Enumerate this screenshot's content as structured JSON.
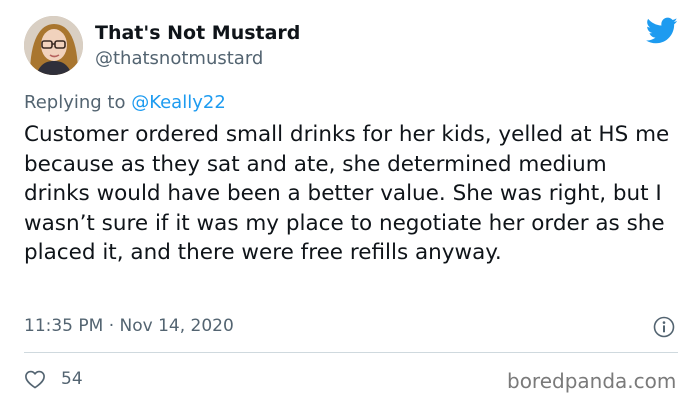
{
  "tweet": {
    "author": {
      "display_name": "That's Not Mustard",
      "handle": "@thatsnotmustard",
      "avatar_icon": "avatar-photo"
    },
    "reply": {
      "prefix": "Replying to ",
      "mention": "@Keally22"
    },
    "text": "Customer ordered small drinks for her kids, yelled at HS me because as they sat and ate, she determined medium drinks would have been a better value. She was right, but I wasn’t sure if it was my place to negotiate her order as she placed it, and there were free refills anyway.",
    "timestamp": "11:35 PM · Nov 14, 2020",
    "likes": "54"
  },
  "icons": {
    "brand": "twitter-bird-icon",
    "info": "info-icon",
    "like": "heart-icon"
  },
  "colors": {
    "accent": "#1d9bf0",
    "text": "#0f1419",
    "secondary": "#536471",
    "divider": "#cfd9de"
  },
  "watermark": "boredpanda.com"
}
